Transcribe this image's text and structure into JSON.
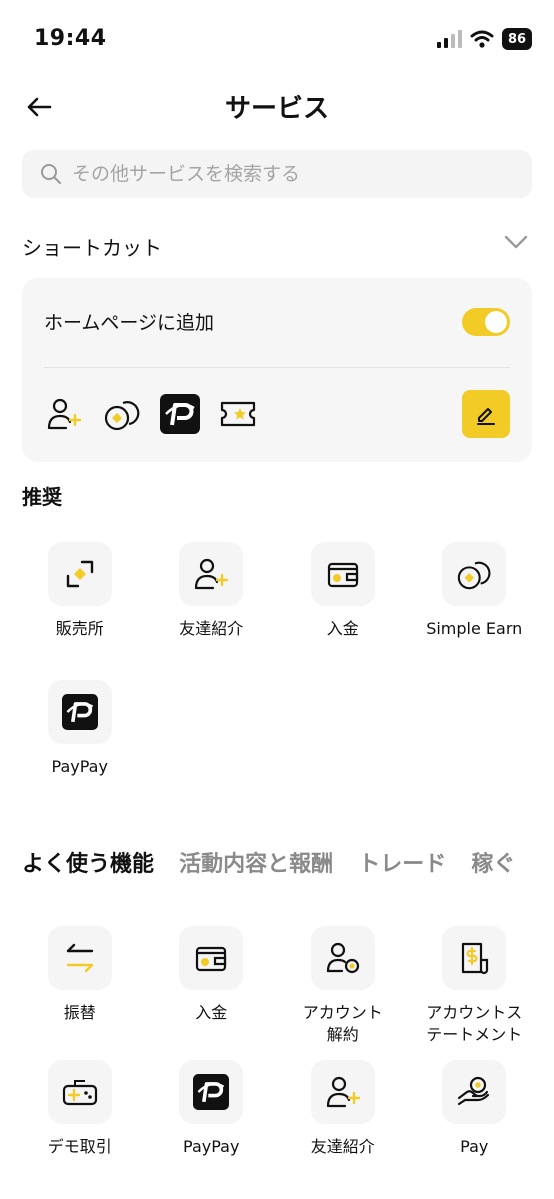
{
  "status_bar": {
    "time": "19:44",
    "battery": "86"
  },
  "header": {
    "title": "サービス"
  },
  "search": {
    "placeholder": "その他サービスを検索する"
  },
  "shortcut": {
    "title": "ショートカット",
    "home_label": "ホームページに追加",
    "toggle_on": true,
    "icons": [
      "add-friend-icon",
      "coins-icon",
      "paypay-icon",
      "ticket-icon"
    ]
  },
  "recommended": {
    "title": "推奨",
    "items": [
      {
        "label": "販売所",
        "icon": "exchange-corner-icon"
      },
      {
        "label": "友達紹介",
        "icon": "add-friend-icon"
      },
      {
        "label": "入金",
        "icon": "wallet-icon"
      },
      {
        "label": "Simple Earn",
        "icon": "coins-icon"
      },
      {
        "label": "PayPay",
        "icon": "paypay-icon"
      }
    ]
  },
  "tabs": [
    "よく使う機能",
    "活動内容と報酬",
    "トレード",
    "稼ぐ"
  ],
  "frequent": {
    "items": [
      {
        "label": "振替",
        "icon": "transfer-icon"
      },
      {
        "label": "入金",
        "icon": "wallet-icon"
      },
      {
        "label": "アカウント\n解約",
        "icon": "user-close-icon"
      },
      {
        "label": "アカウントス\nテートメント",
        "icon": "statement-icon"
      },
      {
        "label": "デモ取引",
        "icon": "gamepad-icon"
      },
      {
        "label": "PayPay",
        "icon": "paypay-icon"
      },
      {
        "label": "友達紹介",
        "icon": "add-friend-icon"
      },
      {
        "label": "Pay",
        "icon": "pay-hand-icon"
      }
    ]
  },
  "colors": {
    "accent": "#f2cb26",
    "text": "#111111",
    "muted": "#8a8a8a",
    "surface": "#f5f5f5"
  }
}
